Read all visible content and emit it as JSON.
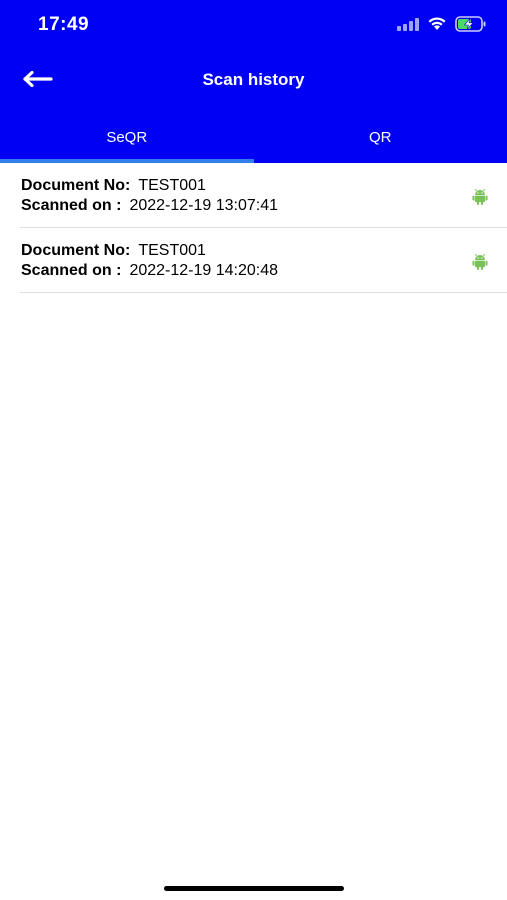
{
  "status_bar": {
    "time": "17:49",
    "signal_icon": "signal-bars-icon",
    "wifi_icon": "wifi-icon",
    "battery_icon": "battery-charging-icon"
  },
  "nav": {
    "back_icon": "arrow-left-icon",
    "title": "Scan history"
  },
  "tabs": [
    {
      "label": "SeQR",
      "selected": true
    },
    {
      "label": "QR",
      "selected": false
    }
  ],
  "history": {
    "doc_label": "Document No:",
    "scan_label": "Scanned on :",
    "items": [
      {
        "document_no": "TEST001",
        "scanned_on": "2022-12-19 13:07:41",
        "platform_icon": "android-icon"
      },
      {
        "document_no": "TEST001",
        "scanned_on": "2022-12-19 14:20:48",
        "platform_icon": "android-icon"
      }
    ]
  },
  "colors": {
    "header_bg": "#0000F5",
    "tab_indicator": "#2F80ED",
    "android_green": "#78C257",
    "divider": "#E0E0E0"
  }
}
